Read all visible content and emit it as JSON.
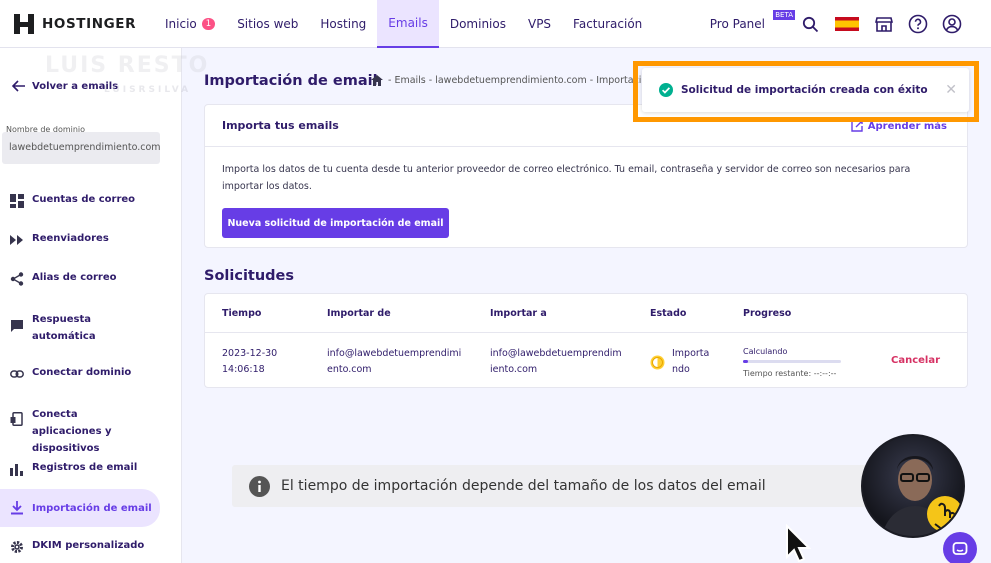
{
  "brand": {
    "name": "HOSTINGER",
    "logo_icon": "hostinger-logo-icon"
  },
  "nav": {
    "items": [
      {
        "label": "Inicio",
        "badge": "1"
      },
      {
        "label": "Sitios web"
      },
      {
        "label": "Hosting"
      },
      {
        "label": "Emails",
        "active": true
      },
      {
        "label": "Dominios"
      },
      {
        "label": "VPS"
      },
      {
        "label": "Facturación"
      }
    ],
    "pro_panel": "Pro Panel",
    "beta": "BETA",
    "icons": [
      "search-icon",
      "spain-flag-icon",
      "store-icon",
      "help-icon",
      "account-icon"
    ]
  },
  "watermark": {
    "name": "LUIS RESTO",
    "handle": "LUISRSILVA"
  },
  "sidebar": {
    "back_label": "Volver a emails",
    "domain_label": "Nombre de dominio",
    "domain_value": "lawebdetuemprendimiento.com",
    "items": [
      {
        "label": "Cuentas de correo",
        "icon": "dashboard-icon"
      },
      {
        "label": "Reenviadores",
        "icon": "forward-icon"
      },
      {
        "label": "Alias de correo",
        "icon": "share-icon"
      },
      {
        "label": "Respuesta automática",
        "icon": "auto-reply-icon"
      },
      {
        "label": "Conectar dominio",
        "icon": "link-icon"
      },
      {
        "label": "Conecta aplicaciones y dispositivos",
        "icon": "devices-icon"
      },
      {
        "label": "Registros de email",
        "icon": "bar-chart-icon"
      },
      {
        "label": "Importación de email",
        "icon": "download-icon",
        "active": true
      },
      {
        "label": "DKIM personalizado",
        "icon": "gear-icon"
      }
    ]
  },
  "main": {
    "title": "Importación de email",
    "breadcrumb": "- Emails - lawebdetuemprendimiento.com - Importaci",
    "import_card": {
      "title": "Importa tus emails",
      "learn_more": "Aprender más",
      "description": "Importa los datos de tu cuenta desde tu anterior proveedor de correo electrónico. Tu email, contraseña y servidor de correo son necesarios para importar los datos.",
      "button": "Nueva solicitud de importación de email"
    },
    "requests": {
      "title": "Solicitudes",
      "columns": [
        "Tiempo",
        "Importar de",
        "Importar a",
        "Estado",
        "Progreso"
      ],
      "rows": [
        {
          "time_date": "2023-12-30",
          "time_clock": "14:06:18",
          "from_l1": "info@lawebdetuemprendimi",
          "from_l2": "ento.com",
          "to_l1": "info@lawebdetuemprendim",
          "to_l2": "iento.com",
          "status_l1": "Importa",
          "status_l2": "ndo",
          "progress_label": "Calculando",
          "progress_fraction": 0.05,
          "remaining": "Tiempo restante: --:--:--",
          "action": "Cancelar"
        }
      ]
    }
  },
  "toast": {
    "message": "Solicitud de importación creada con éxito",
    "icon": "check-circle-icon"
  },
  "caption": "El tiempo de importación depende del tamaño de los datos del email",
  "colors": {
    "accent": "#673de6",
    "danger": "#d63163",
    "success": "#00b090",
    "highlight": "#ff9800"
  }
}
